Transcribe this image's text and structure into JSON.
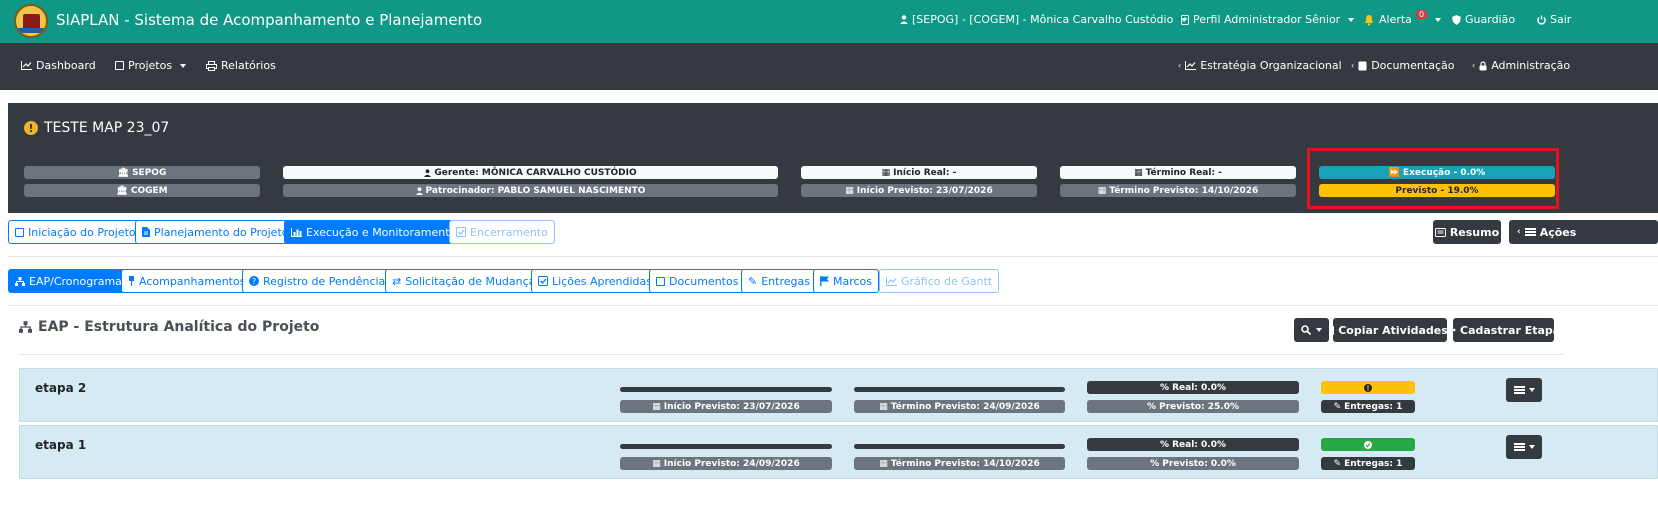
{
  "app": {
    "title": "SIAPLAN - Sistema de Acompanhamento e Planejamento"
  },
  "topbar": {
    "user": "[SEPOG] - [COGEM] - Mônica Carvalho Custódio",
    "profile": "Perfil Administrador Sênior",
    "alert": "Alerta",
    "alert_count": "0",
    "guardian": "Guardião",
    "logout": "Sair"
  },
  "nav": {
    "dashboard": "Dashboard",
    "projects": "Projetos",
    "reports": "Relatórios",
    "strategy": "Estratégia Organizacional",
    "documentation": "Documentação",
    "admin": "Administração"
  },
  "project": {
    "title": "TESTE MAP 23_07",
    "org1": "SEPOG",
    "org2": "COGEM",
    "manager": "Gerente: MÔNICA CARVALHO CUSTÓDIO",
    "sponsor": "Patrocinador: PABLO SAMUEL NASCIMENTO",
    "start_real": "Início Real: -",
    "start_planned": "Início Previsto: 23/07/2026",
    "end_real": "Término Real: -",
    "end_planned": "Término Previsto: 14/10/2026",
    "execution": "Execução - 0.0%",
    "planned": "Previsto - 19.0%"
  },
  "phases": {
    "initiation": "Iniciação do Projeto",
    "planning": "Planejamento do Projeto",
    "execution": "Execução e Monitoramento",
    "closing": "Encerramento",
    "summary": "Resumo",
    "actions": "Ações"
  },
  "subtabs": {
    "wbs": "EAP/Cronograma",
    "tracking": "Acompanhamentos",
    "pending": "Registro de Pendências",
    "change": "Solicitação de Mudança",
    "lessons": "Lições Aprendidas",
    "documents": "Documentos",
    "deliveries": "Entregas",
    "milestones": "Marcos",
    "gantt": "Gráfico de Gantt"
  },
  "eap": {
    "title": "EAP - Estrutura Analítica do Projeto",
    "copy_button": "Copiar Atividades",
    "add_button": "Cadastrar Etapa"
  },
  "stages": [
    {
      "name": "etapa 2",
      "start_planned": "Início Previsto: 23/07/2026",
      "end_planned": "Término Previsto: 24/09/2026",
      "pct_real": "% Real: 0.0%",
      "pct_planned": "% Previsto: 25.0%",
      "status": "warning",
      "deliveries": "Entregas: 1"
    },
    {
      "name": "etapa 1",
      "start_planned": "Início Previsto: 24/09/2026",
      "end_planned": "Término Previsto: 14/10/2026",
      "pct_real": "% Real: 0.0%",
      "pct_planned": "% Previsto: 0.0%",
      "status": "success",
      "deliveries": "Entregas: 1"
    }
  ],
  "colors": {
    "topbar": "#0e9885",
    "navbar": "#343a40",
    "primary": "#007bff",
    "info": "#17a2b8",
    "warning": "#ffc107",
    "success": "#28a745",
    "highlight": "#e3141b"
  }
}
